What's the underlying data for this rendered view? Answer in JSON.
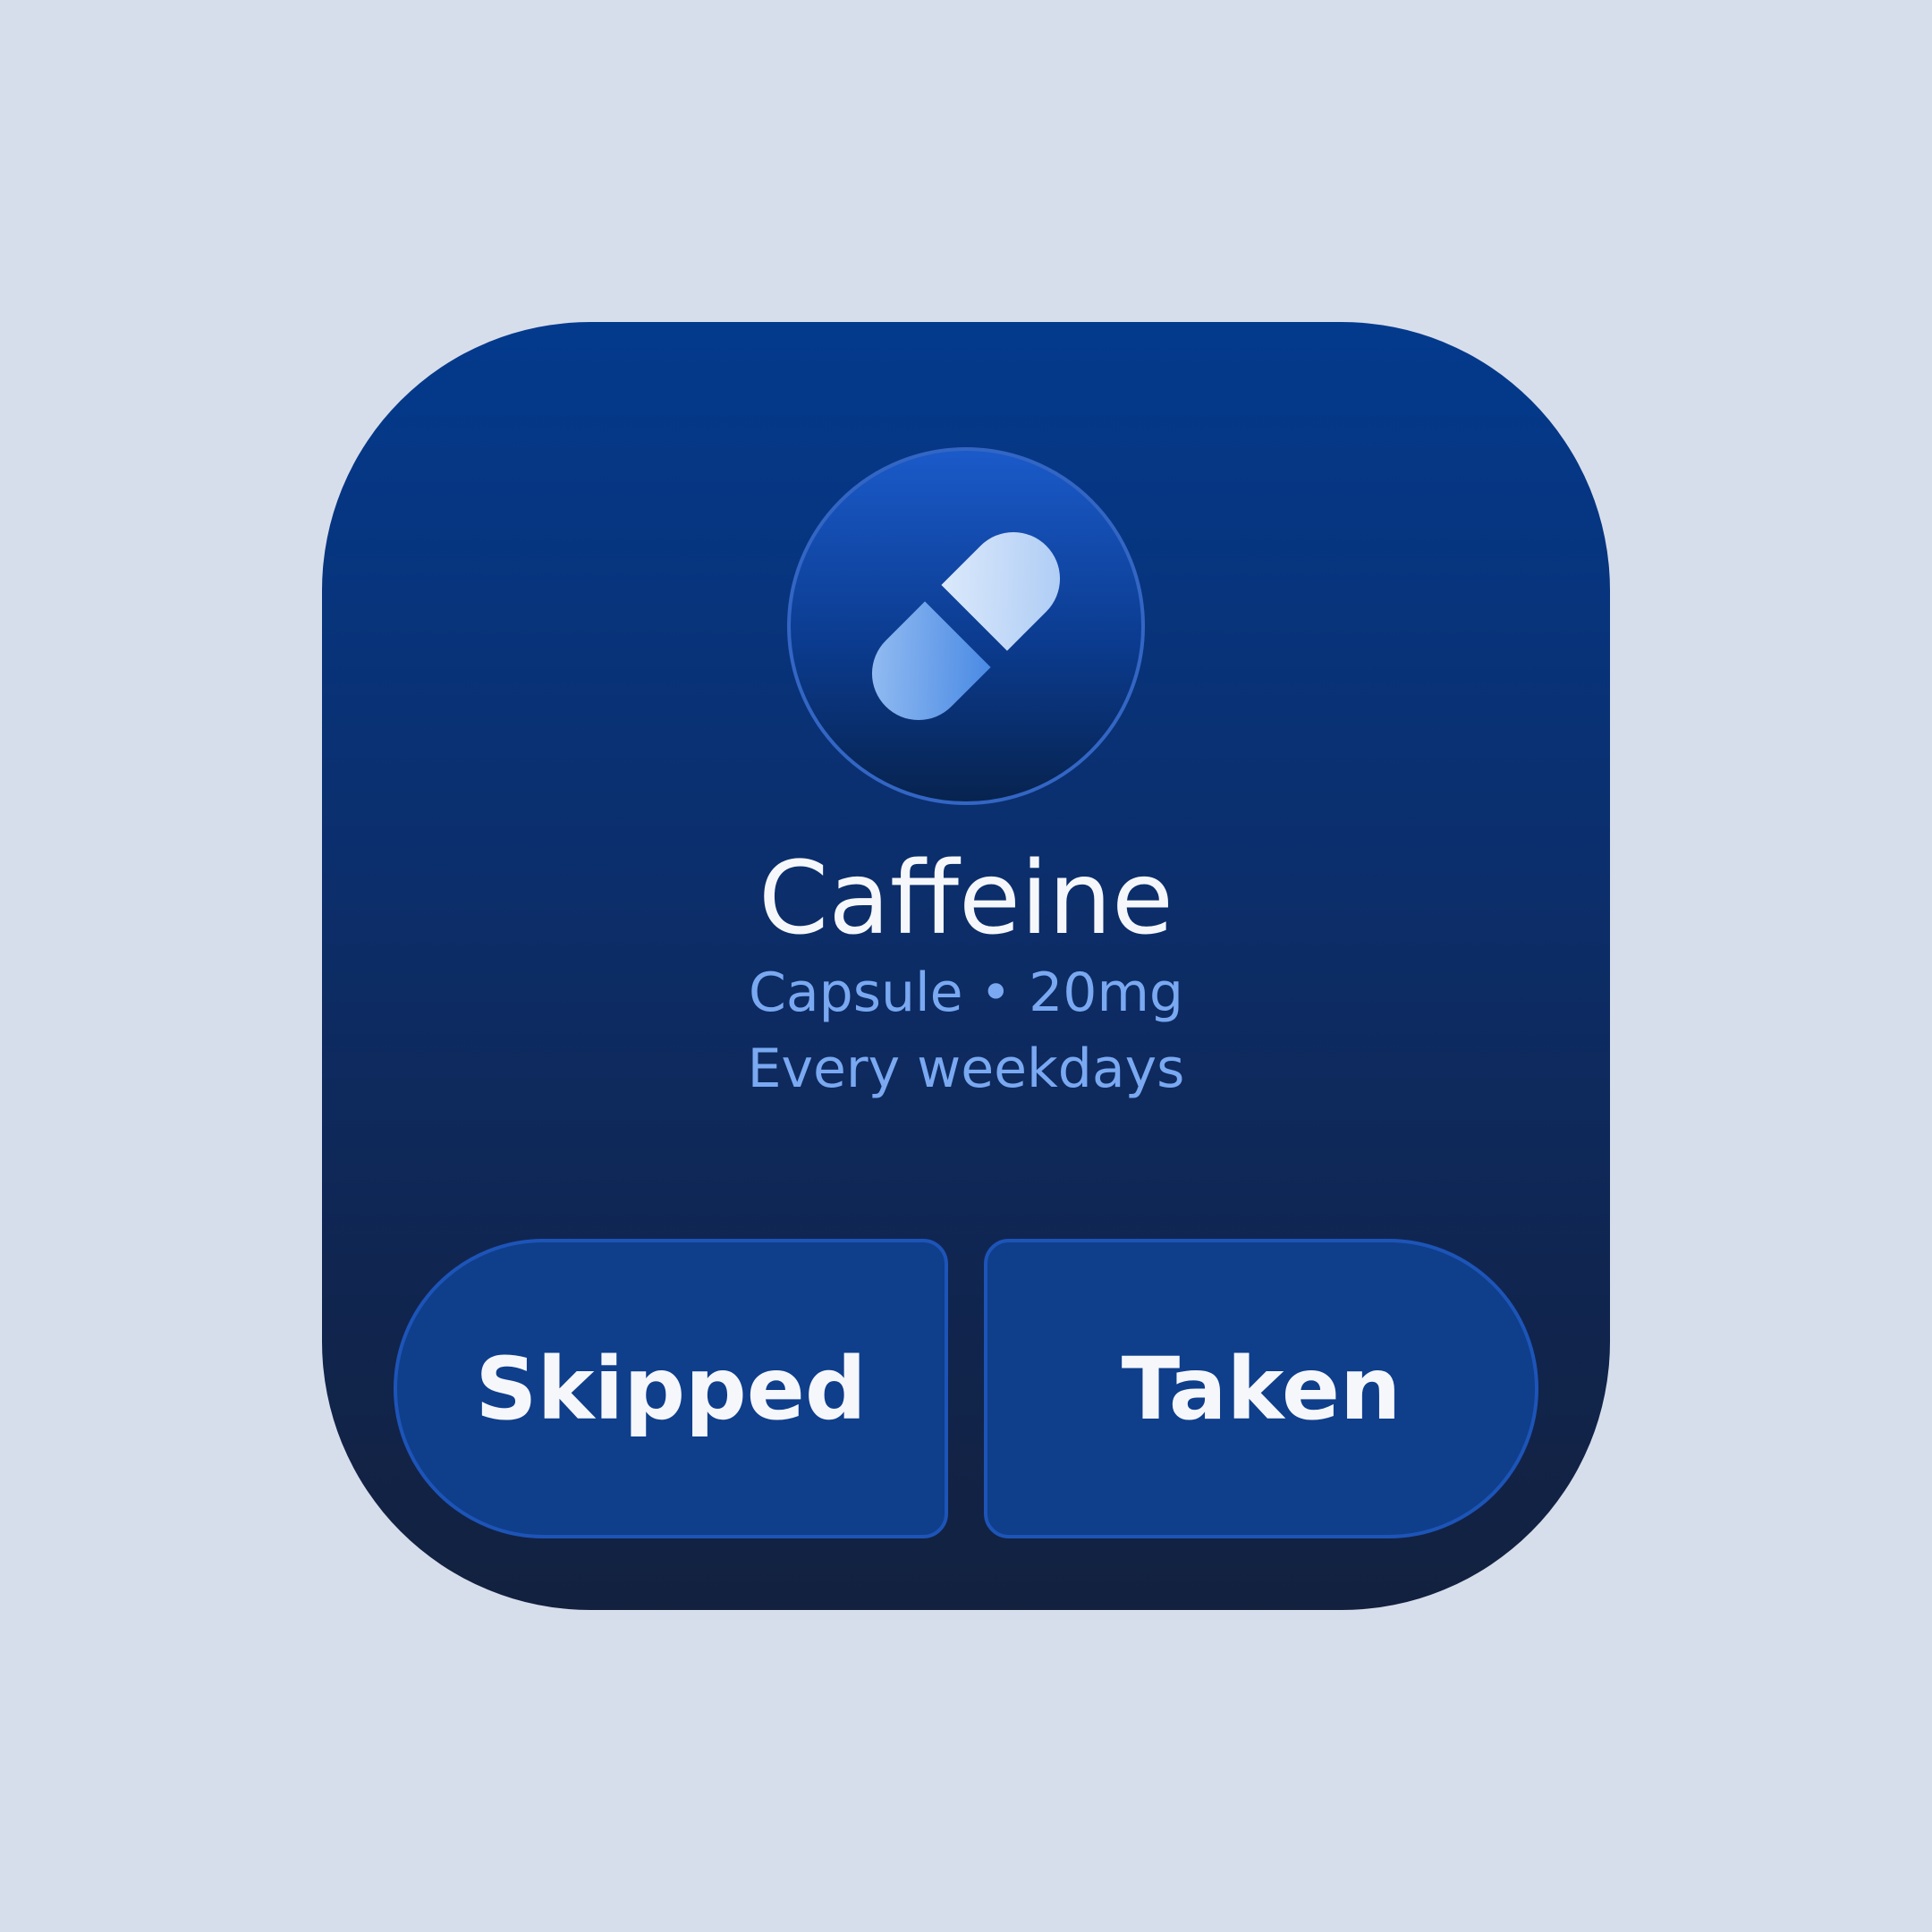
{
  "widget": {
    "icon": "pill-capsule-icon",
    "name": "Caffeine",
    "dosage": "Capsule • 20mg",
    "schedule": "Every weekdays"
  },
  "actions": {
    "skipped_label": "Skipped",
    "taken_label": "Taken"
  },
  "colors": {
    "background": "#d7deeb",
    "widget_top": "#033a8d",
    "widget_bottom": "#13213f",
    "button_fill": "#0f3e8b",
    "accent_text": "#7aa9f2"
  }
}
